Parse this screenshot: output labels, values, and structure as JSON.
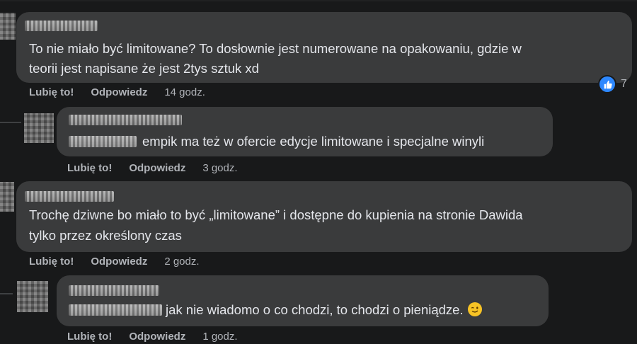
{
  "comments": [
    {
      "text_lines": [
        "To nie miało być limitowane? To dosłownie jest numerowane na opakowaniu, gdzie w",
        "teorii jest napisane że jest 2tys sztuk xd"
      ],
      "like": "Lubię to!",
      "reply": "Odpowiedz",
      "time": "14 godz.",
      "reaction_count": "7"
    },
    {
      "text": "empik ma też w ofercie edycje limitowane i specjalne winyli",
      "like": "Lubię to!",
      "reply": "Odpowiedz",
      "time": "3 godz."
    },
    {
      "text_lines": [
        "Trochę dziwne bo miało to być „limitowane” i dostępne do kupienia na stronie Dawida",
        "tylko przez określony czas"
      ],
      "like": "Lubię to!",
      "reply": "Odpowiedz",
      "time": "2 godz."
    },
    {
      "text": "jak nie wiadomo o co chodzi, to chodzi o pieniądze.",
      "like": "Lubię to!",
      "reply": "Odpowiedz",
      "time": "1 godz."
    }
  ],
  "icons": {
    "reaction": "like-thumb-icon",
    "emoji": "winking-face-icon"
  },
  "colors": {
    "background": "#18191a",
    "bubble": "#3a3b3c",
    "text": "#e4e6eb",
    "secondary": "#b0b3b8",
    "like_blue": "#2d88ff"
  }
}
